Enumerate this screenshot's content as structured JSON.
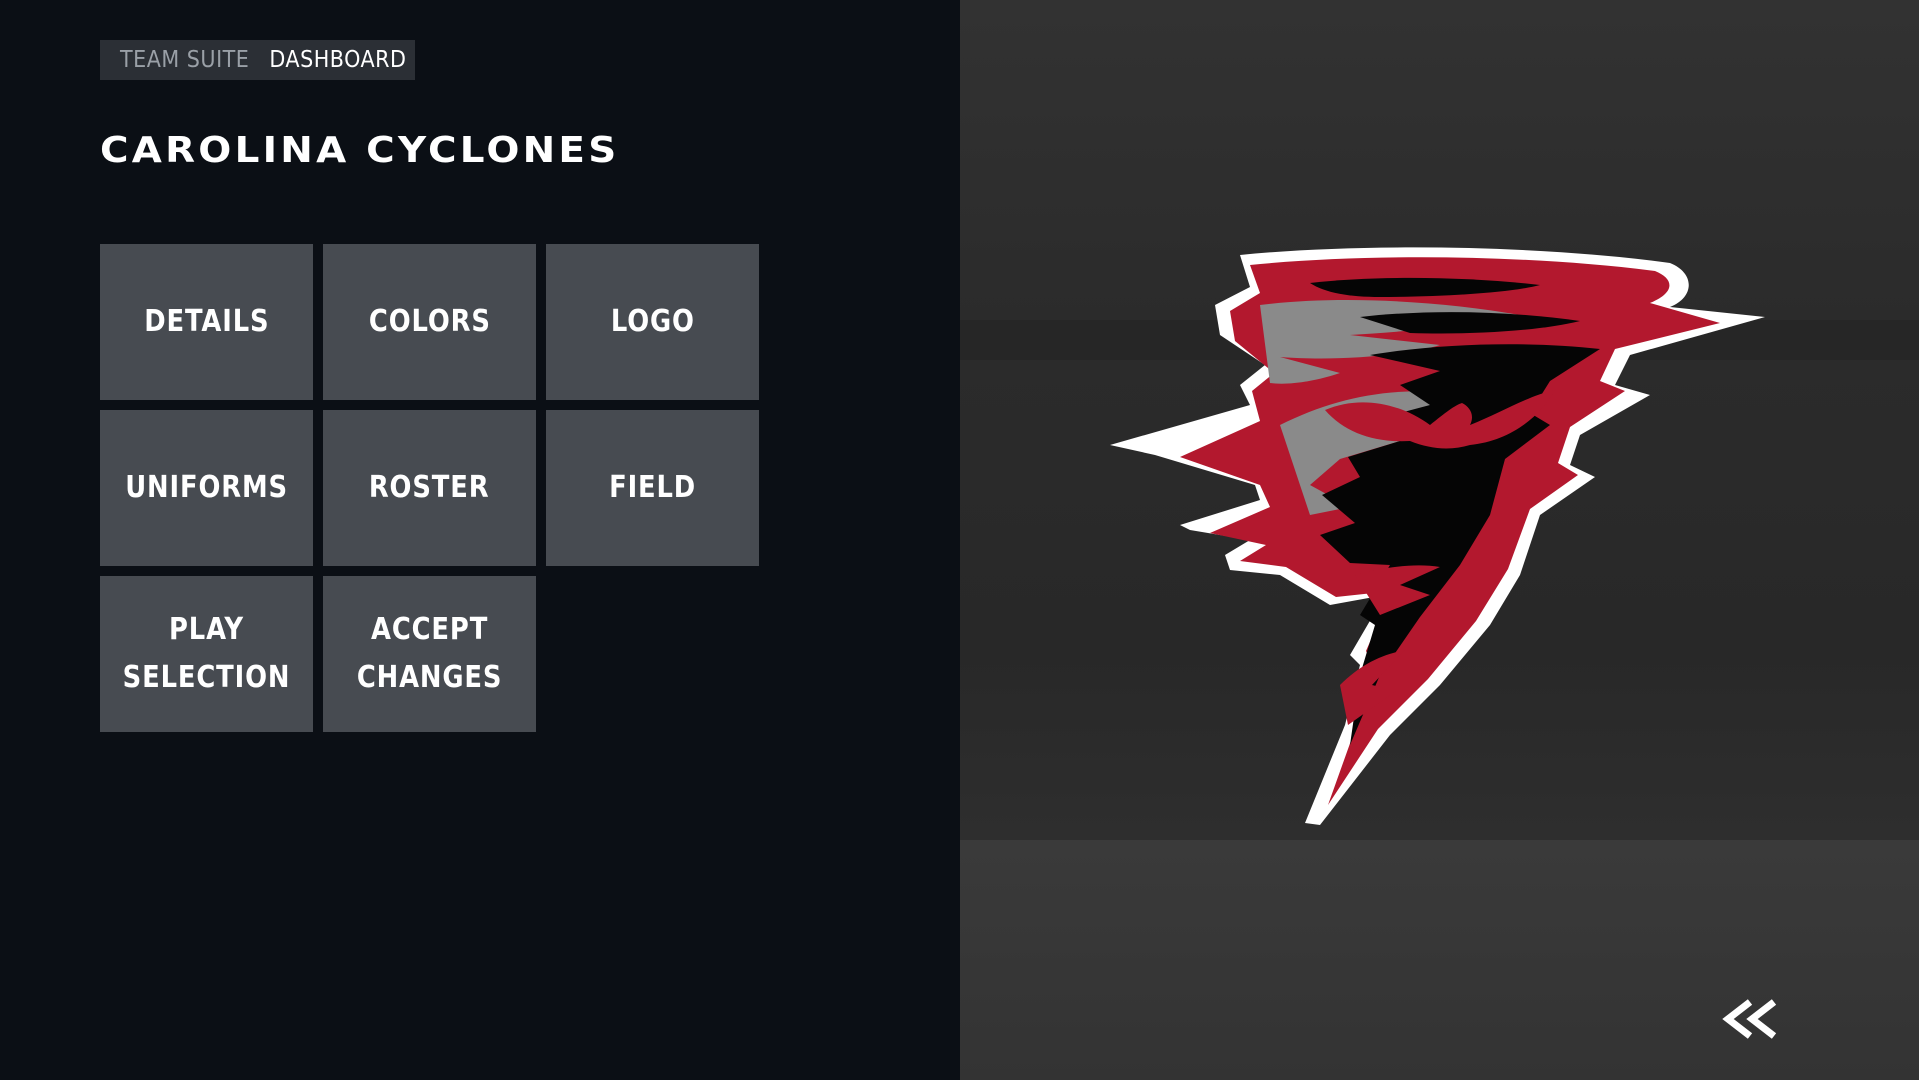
{
  "breadcrumb": {
    "root": "TEAM SUITE",
    "current": "DASHBOARD"
  },
  "team": {
    "name": "CAROLINA CYCLONES"
  },
  "menu": {
    "details": "DETAILS",
    "colors": "COLORS",
    "logo": "LOGO",
    "uniforms": "UNIFORMS",
    "roster": "ROSTER",
    "field": "FIELD",
    "play_selection": "PLAY\nSELECTION",
    "accept_changes": "ACCEPT\nCHANGES"
  },
  "logo": {
    "icon": "cyclone-logo-icon",
    "colors": {
      "red": "#b3182e",
      "black": "#050505",
      "gray": "#8a8a8a",
      "white": "#ffffff"
    }
  },
  "navigation": {
    "back_icon": "double-chevron-left-icon"
  },
  "theme": {
    "panel_bg": "#0b0f15",
    "tile_bg": "#474b51",
    "breadcrumb_bg": "#2b2f35"
  }
}
